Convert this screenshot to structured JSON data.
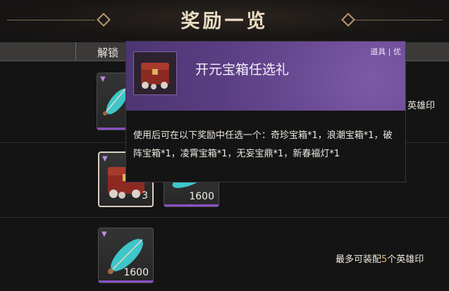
{
  "header": {
    "title": "奖励一览"
  },
  "columns": {
    "unlock_label": "解锁"
  },
  "rows": [
    {
      "slots": [
        {
          "icon": "feather-quill-icon",
          "count": ""
        }
      ],
      "side_text": "英雄印"
    },
    {
      "slots": [
        {
          "icon": "treasure-chest-icon",
          "count": "3",
          "selected": true
        },
        {
          "icon": "feather-quill-icon",
          "count": "1600"
        }
      ],
      "side_text": ""
    },
    {
      "slots": [
        {
          "icon": "feather-quill-icon",
          "count": "1600"
        }
      ],
      "side_text_prefix": "最多可装配",
      "side_text_num": "5",
      "side_text_suffix": "个英雄印"
    }
  ],
  "tooltip": {
    "name": "开元宝箱任选礼",
    "category": "道具",
    "separator": "|",
    "quality": "优",
    "description": "使用后可在以下奖励中任选一个：奇珍宝箱*1，浪潮宝箱*1，破阵宝箱*1，凌霄宝箱*1，无妄宝鼎*1，新春福灯*1"
  },
  "colors": {
    "rarity_purple": "#8a4fc4",
    "highlight": "#e5b85c",
    "tooltip_header": "#6a4a93"
  }
}
